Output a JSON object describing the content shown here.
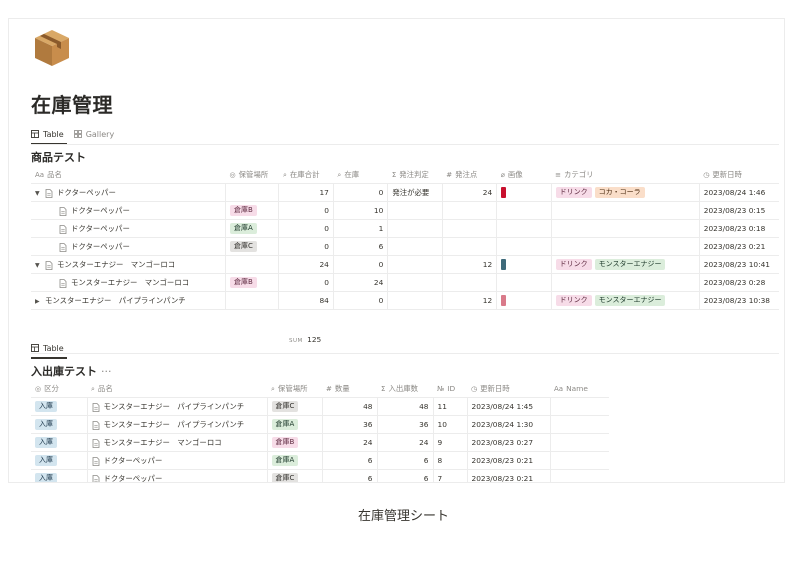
{
  "page": {
    "icon": "package-icon",
    "title": "在庫管理",
    "views": [
      {
        "label": "Table",
        "icon": "table-icon",
        "active": true
      },
      {
        "label": "Gallery",
        "icon": "gallery-icon",
        "active": false
      }
    ]
  },
  "db1": {
    "title": "商品テスト",
    "columns": [
      "品名",
      "保管場所",
      "在庫合計",
      "在庫",
      "発注判定",
      "発注点",
      "画像",
      "カテゴリ",
      "更新日時"
    ],
    "column_icons": [
      "Aa",
      "◎",
      "⌕",
      "⌕",
      "Σ",
      "#",
      "⌀",
      "≡",
      "◷"
    ],
    "rows": [
      {
        "toggle": "▼",
        "indent": 0,
        "name": "ドクターペッパー",
        "location": "",
        "total": "17",
        "stock": "0",
        "judge": "発注が必要",
        "point": "24",
        "image": "red",
        "tags": [
          {
            "label": "ドリンク",
            "color": "pink"
          },
          {
            "label": "コカ・コーラ",
            "color": "salmon"
          }
        ],
        "updated": "2023/08/24 1:46"
      },
      {
        "toggle": "",
        "indent": 1,
        "name": "ドクターペッパー",
        "location": "倉庫B",
        "location_color": "pink",
        "total": "0",
        "stock": "10",
        "judge": "",
        "point": "",
        "image": "",
        "tags": [],
        "updated": "2023/08/23 0:15"
      },
      {
        "toggle": "",
        "indent": 1,
        "name": "ドクターペッパー",
        "location": "倉庫A",
        "location_color": "green",
        "total": "0",
        "stock": "1",
        "judge": "",
        "point": "",
        "image": "",
        "tags": [],
        "updated": "2023/08/23 0:18"
      },
      {
        "toggle": "",
        "indent": 1,
        "name": "ドクターペッパー",
        "location": "倉庫C",
        "location_color": "gray",
        "total": "0",
        "stock": "6",
        "judge": "",
        "point": "",
        "image": "",
        "tags": [],
        "updated": "2023/08/23 0:21"
      },
      {
        "toggle": "▼",
        "indent": 0,
        "name": "モンスターエナジー　マンゴーロコ",
        "location": "",
        "total": "24",
        "stock": "0",
        "judge": "",
        "point": "12",
        "image": "teal",
        "tags": [
          {
            "label": "ドリンク",
            "color": "pink"
          },
          {
            "label": "モンスターエナジー",
            "color": "green"
          }
        ],
        "updated": "2023/08/23 10:41"
      },
      {
        "toggle": "",
        "indent": 1,
        "name": "モンスターエナジー　マンゴーロコ",
        "location": "倉庫B",
        "location_color": "pink",
        "total": "0",
        "stock": "24",
        "judge": "",
        "point": "",
        "image": "",
        "tags": [],
        "updated": "2023/08/23 0:28"
      },
      {
        "toggle": "▶",
        "indent": 0,
        "name": "モンスターエナジー　パイプラインパンチ",
        "location": "",
        "total": "84",
        "stock": "0",
        "judge": "",
        "point": "12",
        "image": "rose",
        "tags": [
          {
            "label": "ドリンク",
            "color": "pink"
          },
          {
            "label": "モンスターエナジー",
            "color": "green"
          }
        ],
        "updated": "2023/08/23 10:38",
        "nodoc": true
      }
    ],
    "sum_label": "SUM",
    "sum_value": "125"
  },
  "db2": {
    "view_label": "Table",
    "title": "入出庫テスト",
    "more": "···",
    "columns": [
      "区分",
      "品名",
      "保管場所",
      "数量",
      "入出庫数",
      "ID",
      "更新日時",
      "Name"
    ],
    "column_icons": [
      "◎",
      "⌕",
      "⌕",
      "#",
      "Σ",
      "№",
      "◷",
      "Aa"
    ],
    "rows": [
      {
        "kind": "入庫",
        "name": "モンスターエナジー　パイプラインパンチ",
        "location": "倉庫C",
        "location_color": "gray",
        "qty": "48",
        "io": "48",
        "id": "11",
        "updated": "2023/08/24 1:45"
      },
      {
        "kind": "入庫",
        "name": "モンスターエナジー　パイプラインパンチ",
        "location": "倉庫A",
        "location_color": "green",
        "qty": "36",
        "io": "36",
        "id": "10",
        "updated": "2023/08/24 1:30"
      },
      {
        "kind": "入庫",
        "name": "モンスターエナジー　マンゴーロコ",
        "location": "倉庫B",
        "location_color": "pink",
        "qty": "24",
        "io": "24",
        "id": "9",
        "updated": "2023/08/23 0:27"
      },
      {
        "kind": "入庫",
        "name": "ドクターペッパー",
        "location": "倉庫A",
        "location_color": "green",
        "qty": "6",
        "io": "6",
        "id": "8",
        "updated": "2023/08/23 0:21"
      },
      {
        "kind": "入庫",
        "name": "ドクターペッパー",
        "location": "倉庫C",
        "location_color": "gray",
        "qty": "6",
        "io": "6",
        "id": "7",
        "updated": "2023/08/23 0:21"
      }
    ]
  },
  "caption": "在庫管理シート",
  "colors": {
    "pink": "#f7dce8",
    "green": "#dbeddb",
    "gray": "#e3e2e0",
    "blue": "#d3e5ef",
    "salmon": "#fadec9",
    "text": "#37352f"
  }
}
